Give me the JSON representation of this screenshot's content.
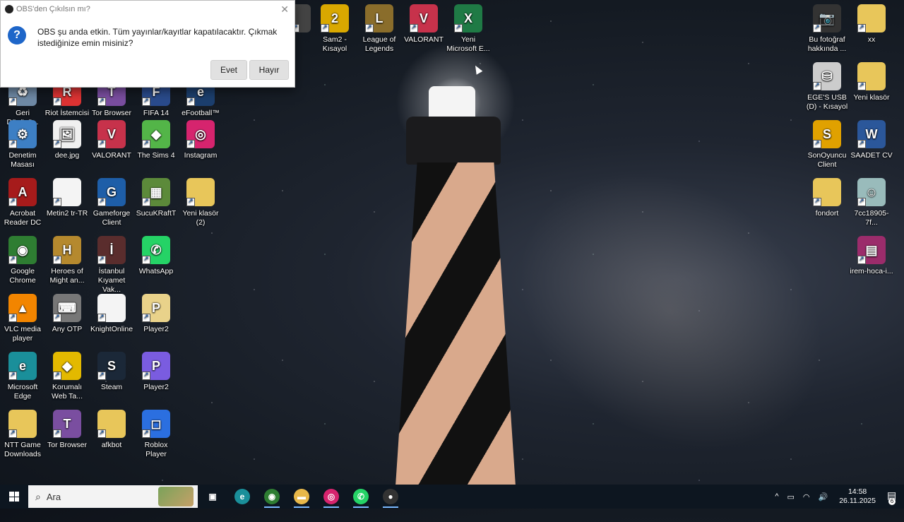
{
  "dialog": {
    "title": "OBS'den Çıkılsın mı?",
    "message": "OBS şu anda etkin. Tüm yayınlar/kayıtlar kapatılacaktır. Çıkmak istediğinize emin misiniz?",
    "yes_label": "Evet",
    "no_label": "Hayır",
    "close_glyph": "✕",
    "icon_glyph": "?"
  },
  "desktop": {
    "icons": [
      {
        "label": "ID -\nyol",
        "color": "#444",
        "glyph": ""
      },
      {
        "label": "Sam2 -\nKısayol",
        "color": "#d9a800",
        "glyph": "2"
      },
      {
        "label": "League of\nLegends",
        "color": "#8a6d2b",
        "glyph": "L"
      },
      {
        "label": "VALORANT",
        "color": "#c7324b",
        "glyph": "V"
      },
      {
        "label": "Yeni\nMicrosoft E...",
        "color": "#1f7a45",
        "glyph": "X"
      },
      {
        "label": "Geri\nDönüşü...",
        "color": "#6f8aa6",
        "glyph": "♻"
      },
      {
        "label": "Riot İstemcisi",
        "color": "#d33",
        "glyph": "R"
      },
      {
        "label": "Tor Browser",
        "color": "#7a4ea0",
        "glyph": "T"
      },
      {
        "label": "FIFA 14",
        "color": "#2a4b8c",
        "glyph": "F"
      },
      {
        "label": "eFootball™",
        "color": "#1c3f6e",
        "glyph": "e"
      },
      {
        "label": "Denetim\nMasası",
        "color": "#3d7fc4",
        "glyph": "⚙"
      },
      {
        "label": "dee.jpg",
        "color": "#f0f0f0",
        "glyph": "🖼"
      },
      {
        "label": "VALORANT",
        "color": "#c7324b",
        "glyph": "V"
      },
      {
        "label": "The Sims 4",
        "color": "#53b548",
        "glyph": "◆"
      },
      {
        "label": "Instagram",
        "color": "#d6246e",
        "glyph": "◎"
      },
      {
        "label": "Acrobat\nReader DC",
        "color": "#a61b1b",
        "glyph": "A"
      },
      {
        "label": "Metin2 tr-TR",
        "color": "#f4f4f4",
        "glyph": ""
      },
      {
        "label": "Gameforge\nClient",
        "color": "#1e5ea8",
        "glyph": "G"
      },
      {
        "label": "SucuKRaftT",
        "color": "#5c8a3a",
        "glyph": "▦"
      },
      {
        "label": "Yeni klasör\n(2)",
        "color": "#e8c65a",
        "glyph": ""
      },
      {
        "label": "Google\nChrome",
        "color": "#2e7d32",
        "glyph": "◉"
      },
      {
        "label": "Heroes of\nMight an...",
        "color": "#b5892e",
        "glyph": "H"
      },
      {
        "label": "İstanbul\nKıyamet Vak...",
        "color": "#5a2d2d",
        "glyph": "İ"
      },
      {
        "label": "WhatsApp",
        "color": "#25d366",
        "glyph": "✆"
      },
      {
        "label": "VLC media\nplayer",
        "color": "#f28500",
        "glyph": "▲"
      },
      {
        "label": "Any OTP",
        "color": "#777",
        "glyph": "⌨"
      },
      {
        "label": "KnightOnline",
        "color": "#f4f4f4",
        "glyph": ""
      },
      {
        "label": "Player2",
        "color": "#e9d28a",
        "glyph": "P"
      },
      {
        "label": "Microsoft\nEdge",
        "color": "#1a8f9a",
        "glyph": "e"
      },
      {
        "label": "Korumalı\nWeb Ta...",
        "color": "#e3b900",
        "glyph": "◆"
      },
      {
        "label": "Steam",
        "color": "#1b2838",
        "glyph": "S"
      },
      {
        "label": "Player2",
        "color": "#7a5ce0",
        "glyph": "P"
      },
      {
        "label": "NTT Game\nDownloads",
        "color": "#e8c65a",
        "glyph": ""
      },
      {
        "label": "Tor Browser",
        "color": "#7a4ea0",
        "glyph": "T"
      },
      {
        "label": "afkbot",
        "color": "#e8c65a",
        "glyph": ""
      },
      {
        "label": "Roblox Player",
        "color": "#2b6fe0",
        "glyph": "◻"
      },
      {
        "label": "Bu fotoğraf\nhakkında ...",
        "color": "#333",
        "glyph": "📷"
      },
      {
        "label": "xx",
        "color": "#e8c65a",
        "glyph": ""
      },
      {
        "label": "EGE'S USB\n(D) - Kısayol",
        "color": "#ccc",
        "glyph": "⛁"
      },
      {
        "label": "Yeni klasör",
        "color": "#e8c65a",
        "glyph": ""
      },
      {
        "label": "SonOyuncu\nClient",
        "color": "#e0a100",
        "glyph": "S"
      },
      {
        "label": "SAADET CV",
        "color": "#2b579a",
        "glyph": "W"
      },
      {
        "label": "fondort",
        "color": "#e8c65a",
        "glyph": ""
      },
      {
        "label": "7cc18905-7f...",
        "color": "#9bb",
        "glyph": "☺"
      },
      {
        "label": "irem-hoca-i...",
        "color": "#9b2c6b",
        "glyph": "▤"
      }
    ]
  },
  "taskbar": {
    "search_placeholder": "Ara",
    "time": "14:58",
    "date": "26.11.2025",
    "notification_count": "6",
    "apps": [
      {
        "name": "task-view",
        "glyph": "▣",
        "color": "transparent"
      },
      {
        "name": "edge",
        "glyph": "e",
        "color": "#1a8f9a"
      },
      {
        "name": "chrome",
        "glyph": "◉",
        "color": "#2e7d32"
      },
      {
        "name": "file-explorer",
        "glyph": "▬",
        "color": "#e8b84a"
      },
      {
        "name": "instagram",
        "glyph": "◎",
        "color": "#d6246e"
      },
      {
        "name": "whatsapp",
        "glyph": "✆",
        "color": "#25d366"
      },
      {
        "name": "obs",
        "glyph": "●",
        "color": "#333"
      }
    ],
    "tray": {
      "chevron": "^",
      "battery": "▭",
      "network": "◠",
      "volume": "🔊"
    }
  }
}
